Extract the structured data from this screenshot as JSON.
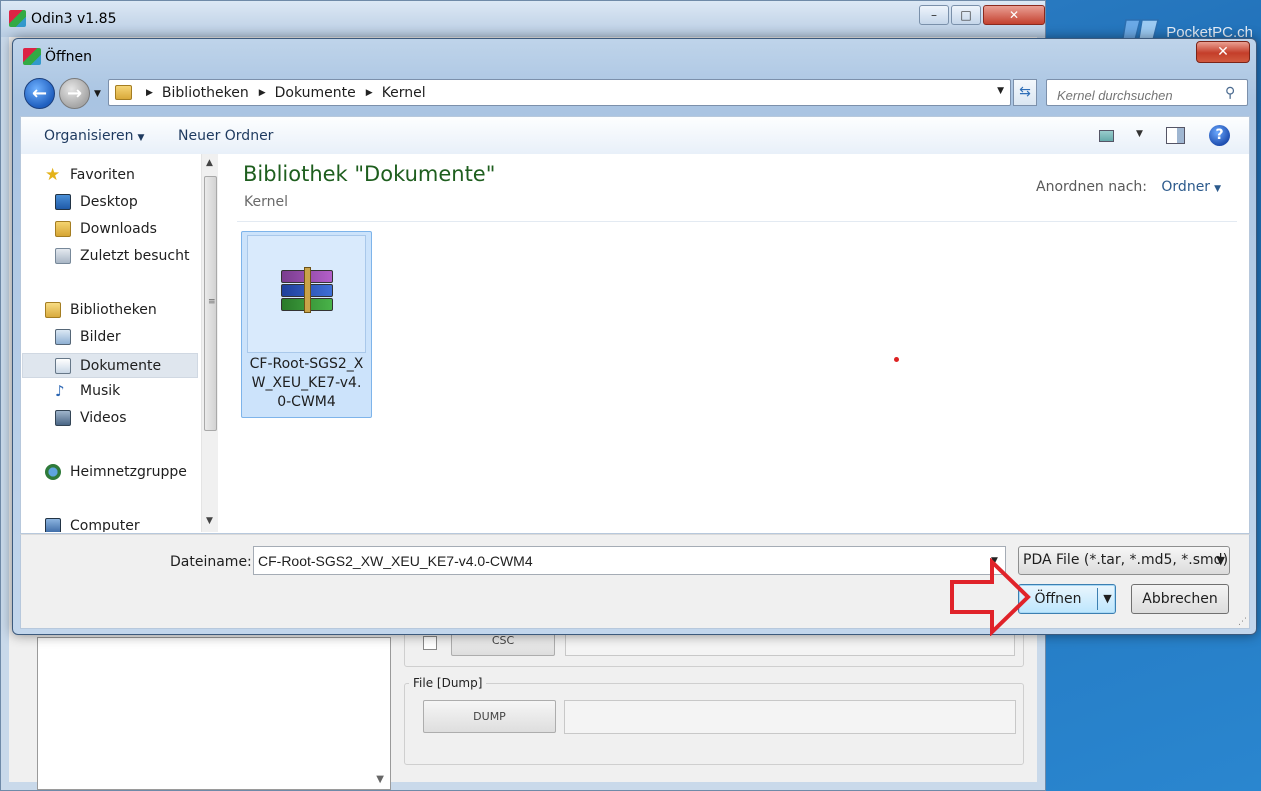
{
  "background_window": {
    "title": "Odin3 v1.85",
    "buttons": {
      "csc": "CSC",
      "dump": "DUMP"
    },
    "group_file_dump": "File [Dump]"
  },
  "logo": {
    "text": "PocketPC.ch"
  },
  "dialog": {
    "title": "Öffnen",
    "address": {
      "crumbs": [
        "Bibliotheken",
        "Dokumente",
        "Kernel"
      ]
    },
    "search": {
      "placeholder": "Kernel durchsuchen"
    },
    "toolbar": {
      "organize": "Organisieren",
      "new_folder": "Neuer Ordner"
    },
    "nav": {
      "favorites": "Favoriten",
      "desktop": "Desktop",
      "downloads": "Downloads",
      "recent": "Zuletzt besucht",
      "libraries": "Bibliotheken",
      "pictures": "Bilder",
      "documents": "Dokumente",
      "music": "Musik",
      "videos": "Videos",
      "homegroup": "Heimnetzgruppe",
      "computer": "Computer"
    },
    "library": {
      "title": "Bibliothek \"Dokumente\"",
      "subtitle": "Kernel",
      "arrange_label": "Anordnen nach:",
      "arrange_value": "Ordner"
    },
    "files": [
      {
        "name": "CF-Root-SGS2_XW_XEU_KE7-v4.0-CWM4",
        "icon": "winrar-archive-icon"
      }
    ],
    "bottom": {
      "filename_label": "Dateiname:",
      "filename_value": "CF-Root-SGS2_XW_XEU_KE7-v4.0-CWM4",
      "filetype_value": "PDA File (*.tar, *.md5, *.smd)",
      "open_label": "Öffnen",
      "cancel_label": "Abbrechen"
    }
  },
  "colors": {
    "library_title": "#1e5e1e",
    "selection": "#cce3fb",
    "annotation_arrow": "#e0232a",
    "close_button": "#c43e2a"
  }
}
